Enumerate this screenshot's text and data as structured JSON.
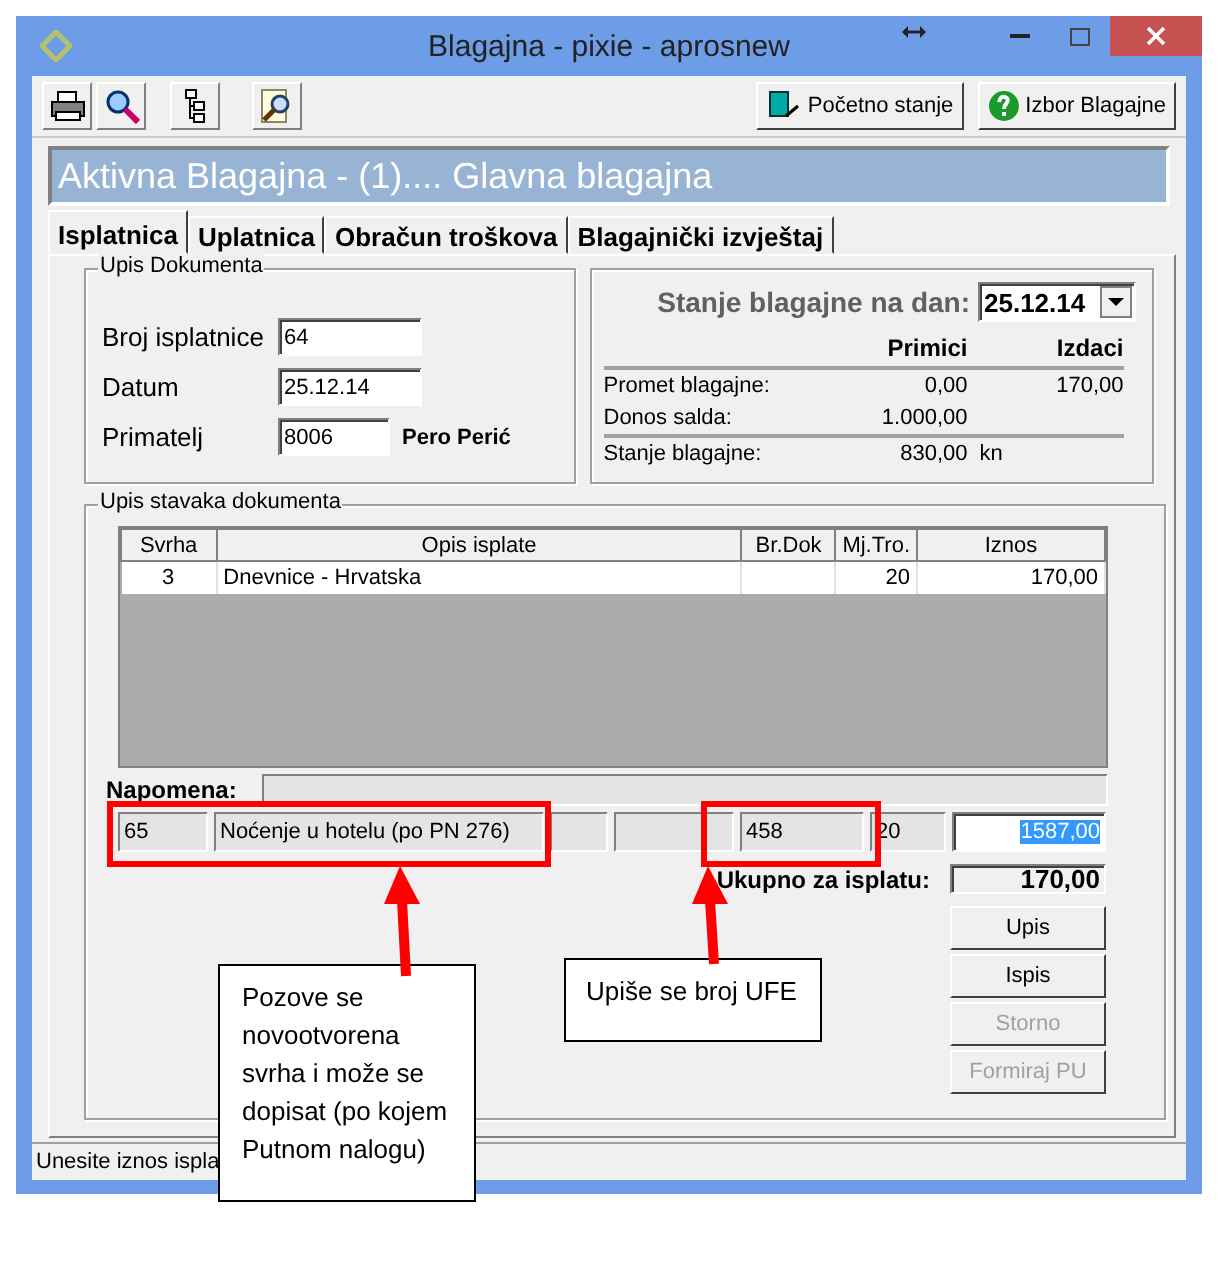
{
  "window": {
    "title": "Blagajna - pixie - aprosnew"
  },
  "toolbar": {
    "buttons": [
      {
        "label": "Početno stanje"
      },
      {
        "label": "Izbor Blagajne"
      }
    ]
  },
  "header": "Aktivna Blagajna - (1).... Glavna blagajna",
  "tabs": [
    {
      "label": "Isplatnica",
      "selected": true
    },
    {
      "label": "Uplatnica",
      "selected": false
    },
    {
      "label": "Obračun troškova",
      "selected": false
    },
    {
      "label": "Blagajnički izvještaj",
      "selected": false
    }
  ],
  "document": {
    "legend": "Upis Dokumenta",
    "fields": [
      {
        "label": "Broj isplatnice",
        "value": "64"
      },
      {
        "label": "Datum",
        "value": "25.12.14"
      },
      {
        "label": "Primatelj",
        "value": "8006",
        "note": "Pero Perić"
      }
    ]
  },
  "balance": {
    "label": "Stanje blagajne na dan:",
    "date": "25.12.14",
    "columns": [
      "Primici",
      "Izdaci"
    ],
    "rows": [
      {
        "label": "Promet blagajne:",
        "primici": "0,00",
        "izdaci": "170,00"
      },
      {
        "label": "Donos salda:",
        "primici": "1.000,00"
      },
      {
        "label": "Stanje blagajne:",
        "primici": "830,00",
        "unit": "kn"
      }
    ]
  },
  "items": {
    "legend": "Upis stavaka dokumenta",
    "table": {
      "columns": [
        "Svrha",
        "Opis isplate",
        "Br.Dok",
        "Mj.Tro.",
        "Iznos"
      ],
      "rows": [
        {
          "svrha": "3",
          "opis": "Dnevnice - Hrvatska",
          "mj_tro": "20",
          "iznos": "170,00"
        }
      ]
    },
    "note_label": "Napomena:",
    "entry": {
      "svrha": "65",
      "opis": "Noćenje u hotelu  (po PN 276)",
      "br_dok": "458",
      "mj_tro": "20",
      "iznos": "1587,00",
      "iznos_highlighted": true
    },
    "total_label": "Ukupno za isplatu:",
    "total": "170,00",
    "buttons": [
      {
        "label": "Upis",
        "disabled": false
      },
      {
        "label": "Ispis",
        "disabled": false
      },
      {
        "label": "Storno",
        "disabled": true
      },
      {
        "label": "Formiraj PU",
        "disabled": true
      }
    ]
  },
  "status_bar": "Unesite iznos ispla",
  "annotations": [
    {
      "text": "Pozove se novootvorena svrha i može se dopisat (po kojem Putnom nalogu)"
    },
    {
      "text": "Upiše se broj UFE"
    }
  ]
}
